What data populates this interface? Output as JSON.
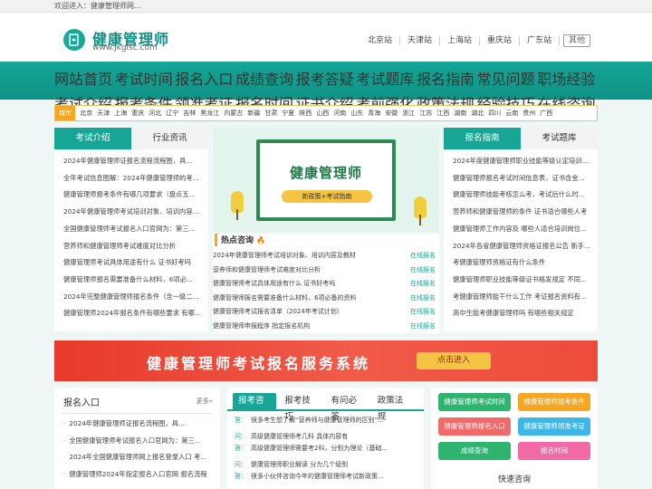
{
  "topbar": {
    "welcome": "欢迎进入：健康管理师网..."
  },
  "header": {
    "logo_title": "健康管理师",
    "logo_sub": "www.jkglsc.com",
    "stations": [
      "北京站",
      "天津站",
      "上海站",
      "重庆站",
      "广东站"
    ],
    "other": "其他"
  },
  "nav": {
    "items": [
      "网站首页",
      "考试时间",
      "报名入口",
      "成绩查询",
      "报考答疑",
      "考试题库",
      "报名指南",
      "常见问题",
      "职场经验",
      "考试介绍",
      "报考条件",
      "领准考证",
      "报名时间",
      "证书介绍",
      "考前强化",
      "政策法规",
      "经验技巧",
      "在线咨询"
    ]
  },
  "citybar": {
    "label": "城市",
    "cities": [
      "北京",
      "天津",
      "上海",
      "重庆",
      "河北",
      "辽宁",
      "吉林",
      "黑龙江",
      "内蒙古",
      "新疆",
      "甘肃",
      "宁夏",
      "陕西",
      "山西",
      "河南",
      "山东",
      "青海",
      "安徽",
      "浙江",
      "江苏",
      "江西",
      "湖南",
      "湖北",
      "四川",
      "云南",
      "贵州",
      "广西"
    ]
  },
  "left": {
    "tabs": [
      "考试介绍",
      "行业资讯"
    ],
    "items": [
      "2024年健康管理师证报名流程流程图，具...",
      "全年考试信息图解：2024年健康管理师的考...",
      "健康管理师报考条件有哪几项要求（盘点五...",
      "2024年健康管理师考试培训对象、培训内容...",
      "全国健康管理师考试报名入口官网为：第三...",
      "营养师和健康管理师考试难度对比分析",
      "健康管理师考试具体用途有什么 证书好考吗",
      "健康管理师报名需要准备什么材料，6项必...",
      "2024年完整健康管理师报名条件（含一级二...",
      "健康管理师2024年报名条件有哪些要求 有哪..."
    ]
  },
  "banner": {
    "title": "健康管理师",
    "subtitle": "新政策+考试指南"
  },
  "hot": {
    "title": "热点咨询",
    "fire": "🔥",
    "rows": [
      {
        "q": "2024年健康管理师考试培训对象、培训内容及教材",
        "r": "在线报名"
      },
      {
        "q": "营养师和健康管理师考试难度对比分析",
        "r": "在线报名"
      },
      {
        "q": "健康管理师考试具体用途有什么 证书好考吗",
        "r": "在线报名"
      },
      {
        "q": "健康管理师报名需要准备什么材料，6项必备的资料",
        "r": "在线报名"
      },
      {
        "q": "健康管理师考试报名清单（2024年考试计划）",
        "r": "在线报名"
      },
      {
        "q": "健康管理师申报程序 指定报名机构",
        "r": "在线报名"
      }
    ]
  },
  "right": {
    "tabs": [
      "报名指南",
      "考试题库"
    ],
    "items": [
      "2024年度健康管理师职业技能等级认定培训...",
      "健康管理师报名考试时间信息表，证书含金...",
      "健康管理师技能考核怎么考，考试后什么时...",
      "营养师和健康管理师的条件 证书适合哪些人考",
      "健康管理师工作内容及 哪些人适合培训岗位...",
      "2024年各省健康管理师资格证报名公告 新手...",
      "考健康管理师资格证有什么条件",
      "健康管理师职业技能等级证书格发规定 不同...",
      "考健康管理师能干什么工作 考证报名资料有...",
      "高中生能考健康管理师吗 有哪些相关规定"
    ]
  },
  "redbanner": {
    "title": "健康管理师考试报名服务系统",
    "button": "点击进入"
  },
  "reg": {
    "title": "报名入口",
    "more": "更多»",
    "items": [
      "2024年健康管理师证报名流程图，具...",
      "全国健康管理师考试报名入口官网为：第三...",
      "2024年全国健康管理师网上报名登录入口 考...",
      "健康管理师2024年指定报名入口官网 报名流程"
    ]
  },
  "qa": {
    "tabs": [
      "报考咨询",
      "报考技巧",
      "有问必答",
      "政策法规"
    ],
    "lines": [
      {
        "mk": "答：",
        "text": "很多考生想了解“营养师与健康管理师的区别”..."
      },
      {
        "mk": "问：",
        "text": "高级健康管理师考几科 具体内容有"
      },
      {
        "mk": "答：",
        "text": "高级健康管理师需要考2科，分别为理论（基础..."
      },
      {
        "mk": "问：",
        "text": "健康管理师职业解读 分为几个级别"
      },
      {
        "mk": "答：",
        "text": "很多小伙伴咨询今年的健康管理师考试新政策..."
      }
    ]
  },
  "buttons": [
    {
      "label": "健康管理师考试时间",
      "color": "#2db46f"
    },
    {
      "label": "健康管理师报考条件",
      "color": "#f5a623"
    },
    {
      "label": "健康管理师报名入口",
      "color": "#f06a6a"
    },
    {
      "label": "健康管理师领准考证",
      "color": "#3fb6e8"
    },
    {
      "label": "成绩查询",
      "color": "#2db46f"
    },
    {
      "label": "报名时间",
      "color": "#f26aa5"
    }
  ],
  "quick": {
    "title": "快速咨询"
  }
}
